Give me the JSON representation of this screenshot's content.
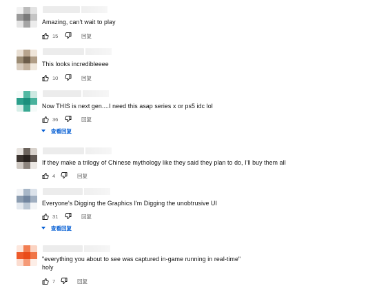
{
  "comments": [
    {
      "author": "",
      "text": "Amazing, can't wait to play",
      "likes": "15",
      "reply_label": "回复",
      "avatar_colors": [
        "#f2f2f2",
        "#bcbcbc",
        "#e3e3e3",
        "#9a9a9a",
        "#7a7a7a",
        "#c4c4c4",
        "#e4e4e4",
        "#a5a5a5",
        "#ececec"
      ]
    },
    {
      "author": "",
      "text": "This looks incredibleeee",
      "likes": "10",
      "reply_label": "回复",
      "avatar_colors": [
        "#e9dfd3",
        "#b7a48d",
        "#efe5d9",
        "#9b8b73",
        "#6d5d49",
        "#b09d86",
        "#d9cdbf",
        "#c3b29e",
        "#efe7dc"
      ]
    },
    {
      "author": "",
      "text": "Now THIS is next gen....I need this asap series x or ps5 idc lol",
      "likes": "36",
      "reply_label": "回复",
      "replies_label": "查看回复",
      "avatar_colors": [
        "#f4fbf9",
        "#52b9a3",
        "#cde9e2",
        "#2b9f8b",
        "#1c8f7c",
        "#48b29c",
        "#d8efe9",
        "#39a892",
        "#f4fbf9"
      ]
    },
    {
      "author": "",
      "text": "If they make a trilogy of Chinese mythology like they said they plan to do, I'll buy them all",
      "likes": "4",
      "reply_label": "回复",
      "avatar_colors": [
        "#e7e3df",
        "#6b635c",
        "#d8d2cc",
        "#3b342f",
        "#27211d",
        "#5f5751",
        "#cfc9c3",
        "#8c847d",
        "#ebe7e3"
      ]
    },
    {
      "author": "",
      "text": "Everyone's Digging the Graphics I'm Digging the unobtrusive UI",
      "likes": "31",
      "reply_label": "回复",
      "replies_label": "查看回复",
      "avatar_colors": [
        "#f1f3f6",
        "#a8b7c8",
        "#dbe2ea",
        "#8b9cb0",
        "#7286a0",
        "#a0afc1",
        "#e4e9ef",
        "#bcc8d5",
        "#f3f5f7"
      ]
    },
    {
      "author": "",
      "text": "\"everything you about to see was captured in-game running in real-time\"",
      "text2": "holy",
      "likes": "7",
      "reply_label": "回复",
      "avatar_colors": [
        "#fde7dd",
        "#f27e52",
        "#fbd4c3",
        "#ee5a2a",
        "#ea4b19",
        "#f07547",
        "#fbdccf",
        "#f59a77",
        "#fdeee7"
      ]
    }
  ]
}
